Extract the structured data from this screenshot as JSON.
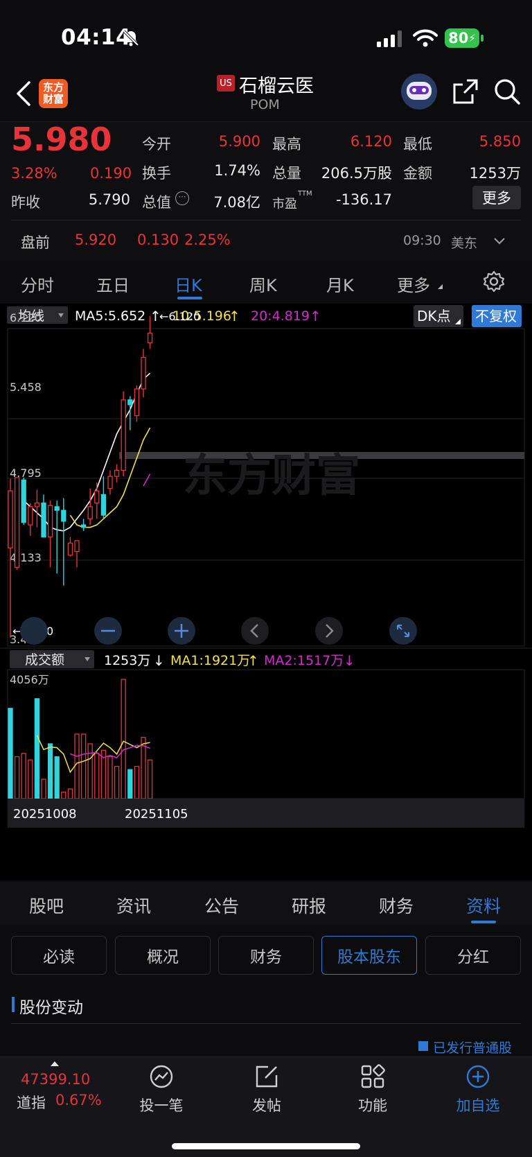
{
  "status_bar": {
    "time": "04:14",
    "battery": "80"
  },
  "header": {
    "logo_text": "东方财富",
    "market_badge": "US",
    "title": "石榴云医",
    "code": "POM"
  },
  "quote": {
    "price": "5.980",
    "change_pct": "3.28%",
    "change": "0.190",
    "prev_close_label": "昨收",
    "prev_close": "5.790",
    "open_label": "今开",
    "open": "5.900",
    "high_label": "最高",
    "high": "6.120",
    "low_label": "最低",
    "low": "5.850",
    "turnover_label": "换手",
    "turnover": "1.74%",
    "volume_label": "总量",
    "volume": "206.5万股",
    "amount_label": "金额",
    "amount": "1253万",
    "mktcap_label": "总值",
    "mktcap": "7.08亿",
    "pe_label": "市盈",
    "pe_sup": "TTM",
    "pe": "-136.17",
    "more_label": "更多",
    "premarket_label": "盘前",
    "premarket_price": "5.920",
    "premarket_change": "0.130",
    "premarket_pct": "2.25%",
    "premarket_time": "09:30",
    "premarket_zone": "美东"
  },
  "period_tabs": [
    "分时",
    "五日",
    "日K",
    "周K",
    "月K",
    "更多"
  ],
  "active_period": "日K",
  "ma_bar": {
    "selector": "均线",
    "ma5": "MA5:5.652",
    "ma10": "10:5.196",
    "ma20": "20:4.819",
    "dk_label": "DK点",
    "adjust_label": "不复权"
  },
  "vol_bar": {
    "selector": "成交额",
    "amount": "1253万",
    "ma1": "MA1:1921万",
    "ma2": "MA2:1517万"
  },
  "watermark": "东方财富",
  "colors": {
    "up": "#e8333a",
    "down": "#2fd4dc",
    "ma5": "#ffffff",
    "ma10": "#f2e24a",
    "ma20": "#d52ad0",
    "accent": "#2f7ad6"
  },
  "chart_data": {
    "type": "candlestick",
    "y_ticks": [
      "6.120",
      "5.458",
      "4.795",
      "4.133",
      "3.470"
    ],
    "ylim": [
      3.47,
      6.12
    ],
    "high_marker": "6.120",
    "low_marker": "3.470",
    "x_labels": [
      "20251008",
      "20251105"
    ],
    "candles": [
      {
        "o": 4.21,
        "h": 4.78,
        "l": 3.47,
        "c": 4.68
      },
      {
        "o": 4.05,
        "h": 4.79,
        "l": 4.03,
        "c": 4.79
      },
      {
        "o": 4.77,
        "h": 4.79,
        "l": 4.4,
        "c": 4.42
      },
      {
        "o": 4.4,
        "h": 4.58,
        "l": 4.31,
        "c": 4.55
      },
      {
        "o": 4.55,
        "h": 4.69,
        "l": 4.38,
        "c": 4.58
      },
      {
        "o": 4.58,
        "h": 4.65,
        "l": 4.3,
        "c": 4.3
      },
      {
        "o": 4.3,
        "h": 4.6,
        "l": 4.05,
        "c": 4.56
      },
      {
        "o": 4.55,
        "h": 4.6,
        "l": 4.0,
        "c": 4.52
      },
      {
        "o": 4.52,
        "h": 4.62,
        "l": 3.9,
        "c": 4.43
      },
      {
        "o": 4.15,
        "h": 4.3,
        "l": 4.14,
        "c": 4.25
      },
      {
        "o": 4.18,
        "h": 4.27,
        "l": 4.05,
        "c": 4.27
      },
      {
        "o": 4.4,
        "h": 4.45,
        "l": 4.35,
        "c": 4.38
      },
      {
        "o": 4.45,
        "h": 4.7,
        "l": 4.4,
        "c": 4.55
      },
      {
        "o": 4.58,
        "h": 4.75,
        "l": 4.45,
        "c": 4.68
      },
      {
        "o": 4.65,
        "h": 4.8,
        "l": 4.45,
        "c": 4.48
      },
      {
        "o": 4.7,
        "h": 4.85,
        "l": 4.65,
        "c": 4.8
      },
      {
        "o": 4.8,
        "h": 4.9,
        "l": 4.75,
        "c": 4.85
      },
      {
        "o": 4.85,
        "h": 5.5,
        "l": 4.8,
        "c": 5.43
      },
      {
        "o": 5.43,
        "h": 5.46,
        "l": 5.18,
        "c": 5.39
      },
      {
        "o": 5.3,
        "h": 5.55,
        "l": 5.25,
        "c": 5.52
      },
      {
        "o": 5.52,
        "h": 5.85,
        "l": 5.45,
        "c": 5.78
      },
      {
        "o": 5.9,
        "h": 6.12,
        "l": 5.85,
        "c": 5.98
      }
    ],
    "ma5": [
      4.6,
      4.55,
      4.5,
      4.45,
      4.38,
      4.36,
      4.35,
      4.38,
      4.45,
      4.52,
      4.6,
      4.7,
      4.85,
      5.0,
      5.15,
      5.25,
      5.35,
      5.48,
      5.6,
      5.65
    ],
    "ma10": [
      4.48,
      4.4,
      4.38,
      4.38,
      4.4,
      4.45,
      4.5,
      4.55,
      4.65,
      4.8,
      4.95,
      5.1,
      5.2
    ],
    "ma20": [
      4.72,
      4.82
    ],
    "volume_max": "4056万",
    "volume": [
      28,
      13,
      14,
      12,
      31,
      6,
      17,
      13,
      2,
      3,
      20,
      20,
      17,
      14,
      15,
      13,
      10,
      37,
      9,
      10,
      19,
      12
    ],
    "volume_up": [
      false,
      true,
      true,
      true,
      false,
      true,
      false,
      false,
      true,
      true,
      true,
      true,
      true,
      true,
      true,
      true,
      true,
      true,
      false,
      true,
      true,
      true
    ]
  },
  "info_tabs": [
    "股吧",
    "资讯",
    "公告",
    "研报",
    "财务",
    "资料"
  ],
  "active_info_tab": "资料",
  "sub_tabs": [
    "必读",
    "概况",
    "财务",
    "股本股东",
    "分红"
  ],
  "active_sub_tab": "股本股东",
  "section_title": "股份变动",
  "legend_issued": "已发行普通股",
  "bottom_nav": {
    "index_value": "47399.10",
    "index_name": "道指",
    "index_pct": "0.67%",
    "invest_label": "投一笔",
    "post_label": "发帖",
    "func_label": "功能",
    "add_label": "加自选"
  }
}
